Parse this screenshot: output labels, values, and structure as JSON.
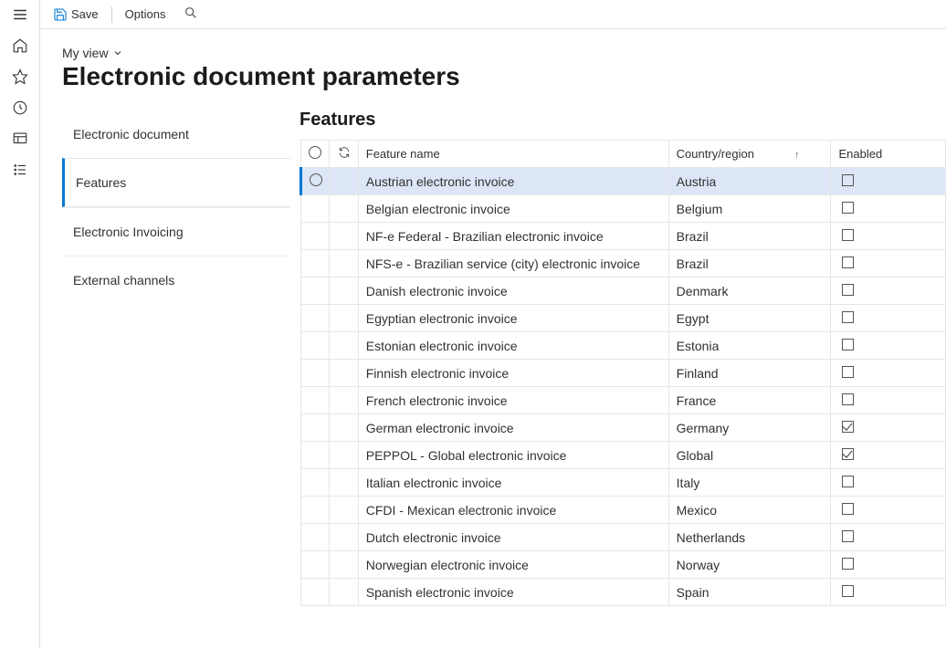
{
  "topbar": {
    "save_label": "Save",
    "options_label": "Options"
  },
  "view_label": "My view",
  "page_title": "Electronic document parameters",
  "nav": {
    "items": [
      {
        "label": "Electronic document",
        "active": false
      },
      {
        "label": "Features",
        "active": true
      },
      {
        "label": "Electronic Invoicing",
        "active": false
      },
      {
        "label": "External channels",
        "active": false
      }
    ]
  },
  "section_title": "Features",
  "columns": {
    "feature": "Feature name",
    "country": "Country/region",
    "enabled": "Enabled"
  },
  "rows": [
    {
      "feature": "Austrian electronic invoice",
      "country": "Austria",
      "enabled": false,
      "selected": true
    },
    {
      "feature": "Belgian electronic invoice",
      "country": "Belgium",
      "enabled": false
    },
    {
      "feature": "NF-e  Federal - Brazilian electronic invoice",
      "country": "Brazil",
      "enabled": false
    },
    {
      "feature": "NFS-e - Brazilian service (city) electronic invoice",
      "country": "Brazil",
      "enabled": false
    },
    {
      "feature": "Danish electronic invoice",
      "country": "Denmark",
      "enabled": false
    },
    {
      "feature": "Egyptian electronic invoice",
      "country": "Egypt",
      "enabled": false
    },
    {
      "feature": "Estonian electronic invoice",
      "country": "Estonia",
      "enabled": false
    },
    {
      "feature": "Finnish electronic invoice",
      "country": "Finland",
      "enabled": false
    },
    {
      "feature": "French electronic invoice",
      "country": "France",
      "enabled": false
    },
    {
      "feature": "German electronic invoice",
      "country": "Germany",
      "enabled": true
    },
    {
      "feature": "PEPPOL - Global electronic invoice",
      "country": "Global",
      "enabled": true
    },
    {
      "feature": "Italian electronic invoice",
      "country": "Italy",
      "enabled": false
    },
    {
      "feature": "CFDI - Mexican electronic invoice",
      "country": "Mexico",
      "enabled": false
    },
    {
      "feature": "Dutch electronic invoice",
      "country": "Netherlands",
      "enabled": false
    },
    {
      "feature": "Norwegian electronic invoice",
      "country": "Norway",
      "enabled": false
    },
    {
      "feature": "Spanish electronic invoice",
      "country": "Spain",
      "enabled": false
    }
  ]
}
